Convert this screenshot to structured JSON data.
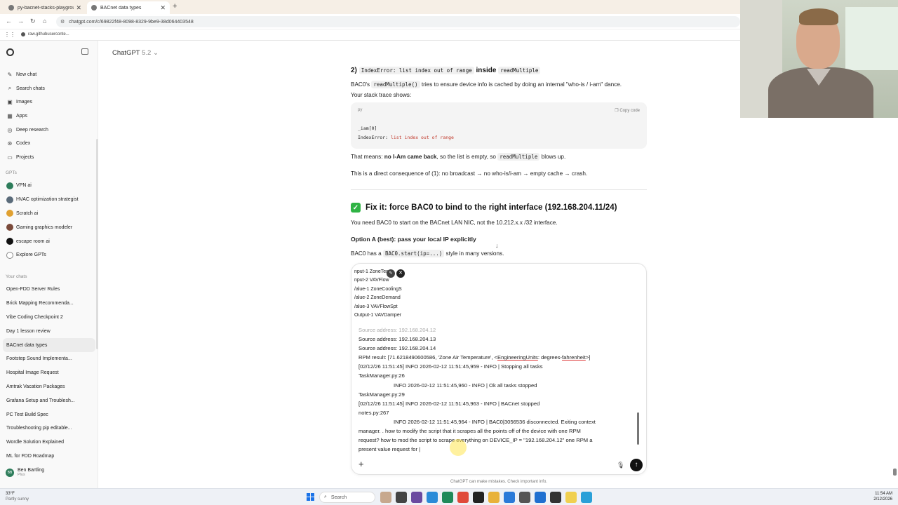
{
  "browser": {
    "tabs": [
      {
        "title": "py-bacnet-stacks-playground/",
        "active": false
      },
      {
        "title": "BACnet data types",
        "active": true
      }
    ],
    "url": "chatgpt.com/c/69822f48-8098-8329-9be9-38d064403548",
    "bookmark": "raw.githubuserconte..."
  },
  "sidebar": {
    "nav": [
      {
        "label": "New chat",
        "icon": "pencil-icon"
      },
      {
        "label": "Search chats",
        "icon": "search-icon"
      },
      {
        "label": "Images",
        "icon": "image-icon"
      },
      {
        "label": "Apps",
        "icon": "apps-icon"
      },
      {
        "label": "Deep research",
        "icon": "deep-research-icon"
      },
      {
        "label": "Codex",
        "icon": "codex-icon"
      },
      {
        "label": "Projects",
        "icon": "folder-icon"
      }
    ],
    "gpts_header": "GPTs",
    "gpts": [
      {
        "label": "VPN ai",
        "color": "#2e7d5b"
      },
      {
        "label": "HVAC optimization strategist",
        "color": "#5a6b7a"
      },
      {
        "label": "Scratch ai",
        "color": "#e0a030"
      },
      {
        "label": "Gaming graphics modeler",
        "color": "#7a4a3a"
      },
      {
        "label": "escape room ai",
        "color": "#111111"
      },
      {
        "label": "Explore GPTs",
        "color": "#888888"
      }
    ],
    "chats_header": "Your chats",
    "chats": [
      "Open-FDD Server Rules",
      "Brick Mapping Recommenda...",
      "Vibe Coding Checkpoint 2",
      "Day 1 lesson review",
      "BACnet data types",
      "Footstep Sound Implementa...",
      "Hospital Image Request",
      "Amtrak Vacation Packages",
      "Grafana Setup and Troublesh...",
      "PC Test Build Spec",
      "Troubleshooting pip editable...",
      "Wordle Solution Explained",
      "ML for FDD Roadmap"
    ],
    "active_chat": "BACnet data types",
    "user": {
      "initials": "BB",
      "name": "Ben Bartling",
      "plan": "Plus"
    }
  },
  "main": {
    "model": "ChatGPT",
    "model_version": "5.2",
    "heading2_prefix": "2)",
    "heading2_code": "IndexError: list index out of range",
    "heading2_mid": "inside",
    "heading2_code2": "readMultiple",
    "p1_prefix": "BAC0's",
    "p1_code": "readMultiple()",
    "p1_suffix": "tries to ensure device info is cached by doing an internal \"who-is / i-am\" dance.",
    "p2": "Your stack trace shows:",
    "code_lang": "py",
    "copy_label": "Copy code",
    "code_line1": "_iam[0]",
    "code_line2_a": "IndexError:",
    "code_line2_b": "list index out of range",
    "p3_prefix": "That means:",
    "p3_bold": "no I-Am came back",
    "p3_mid": ", so the list is empty, so",
    "p3_code": "readMultiple",
    "p3_suffix": "blows up.",
    "p4": "This is a direct consequence of (1): no broadcast → no who-is/i-am → empty cache → crash.",
    "h3": "Fix it: force BAC0 to bind to the right interface (192.168.204.11/24)",
    "p5": "You need BAC0 to start on the BACnet LAN NIC, not the 10.212.x.x /32 interface.",
    "h4": "Option A (best): pass your local IP explicitly",
    "p6_prefix": "BAC0 has a",
    "p6_code": "BAC0.start(ip=...)",
    "p6_suffix": "style in many versions."
  },
  "composer": {
    "attachment_lines": [
      "nput-1 ZoneTemp",
      "nput-2 VAVFlow",
      "/alue-1 ZoneCoolingS",
      "/alue-2 ZoneDemand",
      "/alue-3 VAVFlowSpt",
      "Output-1 VAVDamper"
    ],
    "log": {
      "l0": "Source address: 192.168.204.12",
      "l1": "Source address: 192.168.204.13",
      "l2": "Source address: 192.168.204.14",
      "l3a": "RPM result: [71.6218490600586, 'Zone Air Temperature', <",
      "l3b": "EngineeringUnits",
      "l3c": ": degrees-",
      "l3d": "fahrenheit",
      "l3e": ">]",
      "l4": "[02/12/26 11:51:45] INFO     2026-02-12 11:51:45,959 - INFO    | Stopping all tasks",
      "l5": "TaskManager.py:26",
      "l6": "INFO     2026-02-12 11:51:45,960 - INFO    | Ok all tasks stopped",
      "l7": "TaskManager.py:29",
      "l8": "[02/12/26 11:51:45] INFO     2026-02-12 11:51:45,963 - INFO    | BACnet stopped",
      "l9": "notes.py:267",
      "l10": "INFO     2026-02-12 11:51:45,964 - INFO    | BAC0|3056536 disconnected. Exiting context",
      "l11": "manager.     . how to modify the script that it scrapes all the points off of the device with one RPM",
      "l12": "request? how to mod the script to scrape everything on DEVICE_IP = \"192.168.204.12\" one RPM a",
      "l13": "present value request for |"
    }
  },
  "disclaimer": "ChatGPT can make mistakes. Check important info.",
  "taskbar": {
    "temp": "33°F",
    "weather": "Partly sunny",
    "search": "Search",
    "time": "11:54 AM",
    "date": "2/12/2026"
  }
}
